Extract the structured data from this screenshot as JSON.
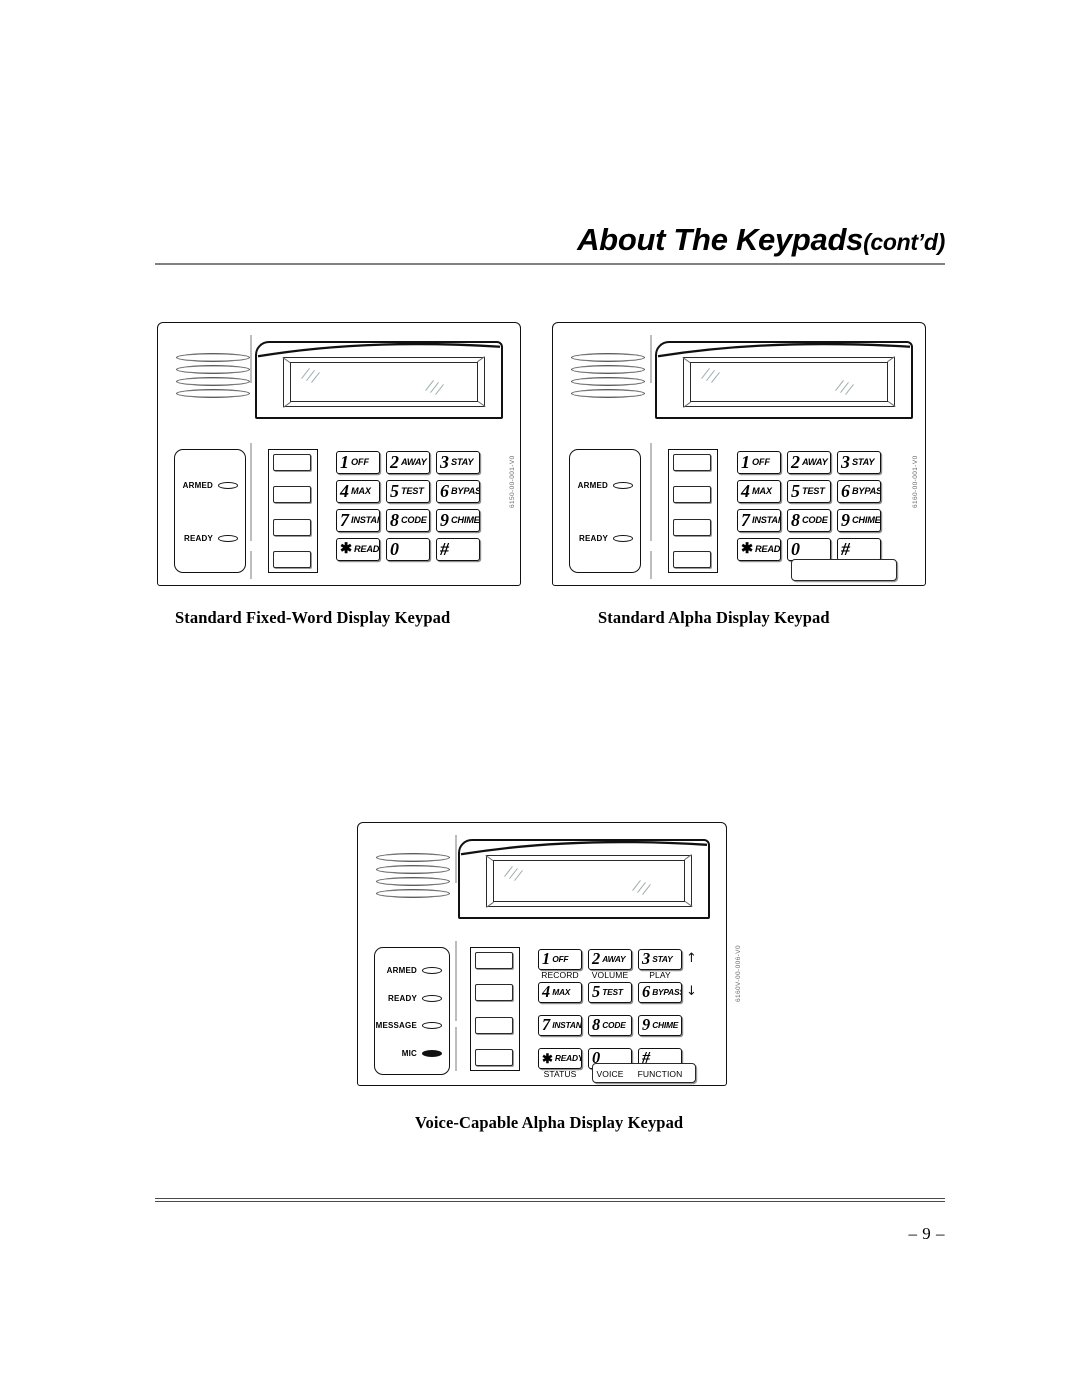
{
  "document": {
    "title_main": "About The Keypads",
    "title_suffix": "(cont’d)",
    "page_number": "– 9 –"
  },
  "key_legend": {
    "row1": [
      {
        "digit": "1",
        "word": "OFF"
      },
      {
        "digit": "2",
        "word": "AWAY"
      },
      {
        "digit": "3",
        "word": "STAY"
      }
    ],
    "row2": [
      {
        "digit": "4",
        "word": "MAX"
      },
      {
        "digit": "5",
        "word": "TEST"
      },
      {
        "digit": "6",
        "word": "BYPASS"
      }
    ],
    "row3": [
      {
        "digit": "7",
        "word": "INSTANT"
      },
      {
        "digit": "8",
        "word": "CODE"
      },
      {
        "digit": "9",
        "word": "CHIME"
      }
    ],
    "row4": [
      {
        "digit": "✱",
        "word": "READY"
      },
      {
        "digit": "0",
        "word": ""
      },
      {
        "digit": "#",
        "word": ""
      }
    ]
  },
  "figures": [
    {
      "id": "fixed-word",
      "caption": "Standard Fixed-Word Display Keypad",
      "indicators": [
        {
          "label": "ARMED",
          "lens": "outline"
        },
        {
          "label": "READY",
          "lens": "outline"
        }
      ],
      "function_keys": [
        "",
        "",
        "",
        ""
      ],
      "has_wide_button": false,
      "part_number": "6150-00-001-V0"
    },
    {
      "id": "alpha",
      "caption": "Standard Alpha Display Keypad",
      "indicators": [
        {
          "label": "ARMED",
          "lens": "outline"
        },
        {
          "label": "READY",
          "lens": "outline"
        }
      ],
      "function_keys": [
        "",
        "",
        "",
        ""
      ],
      "has_wide_button": true,
      "part_number": "6160-00-001-V0"
    },
    {
      "id": "voice-alpha",
      "caption": "Voice-Capable Alpha Display Keypad",
      "indicators": [
        {
          "label": "ARMED",
          "lens": "outline"
        },
        {
          "label": "READY",
          "lens": "outline"
        },
        {
          "label": "MESSAGE",
          "lens": "outline"
        },
        {
          "label": "MIC",
          "lens": "filled"
        }
      ],
      "function_keys": [
        "",
        "",
        "",
        ""
      ],
      "has_wide_button": true,
      "part_number": "6160V-00-006-V0",
      "voice_sublabels_top": [
        "RECORD",
        "VOLUME",
        "PLAY"
      ],
      "voice_sublabels_bottom": [
        "STATUS",
        "VOICE",
        "FUNCTION"
      ],
      "arrows": [
        "↑",
        "↓"
      ]
    }
  ],
  "colors": {
    "ink": "#111111",
    "rule": "#808080",
    "shadow": "#8f8f8f",
    "partnum": "#6a6a6a"
  }
}
